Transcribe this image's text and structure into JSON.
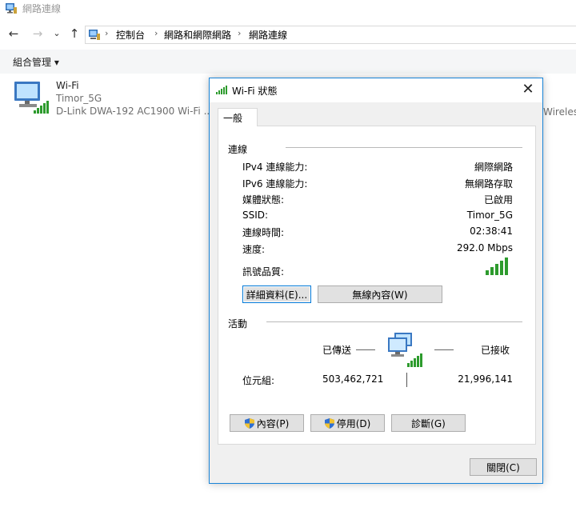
{
  "window": {
    "title": "網路連線"
  },
  "nav": {
    "back": "←",
    "forward": "→",
    "recent": "⌄",
    "up": "↑"
  },
  "breadcrumb": [
    "控制台",
    "網路和網際網路",
    "網路連線"
  ],
  "breadcrumb_sep": "›",
  "commandbar": {
    "organize": "組合管理 ▾"
  },
  "adapter": {
    "name": "Wi-Fi",
    "ssid": "Timor_5G",
    "description": "D-Link DWA-192 AC1900 Wi-Fi ...",
    "icon": "network-adapter-icon"
  },
  "background_text": "Wireles",
  "dialog": {
    "title": "Wi-Fi 狀態",
    "close": "✕",
    "tab": "一般",
    "connection": {
      "label": "連線",
      "rows": [
        {
          "label": "IPv4 連線能力:",
          "value": "網際網路"
        },
        {
          "label": "IPv6 連線能力:",
          "value": "無網路存取"
        },
        {
          "label": "媒體狀態:",
          "value": "已啟用"
        },
        {
          "label": "SSID:",
          "value": "Timor_5G"
        },
        {
          "label": "連線時間:",
          "value": "02:38:41"
        },
        {
          "label": "速度:",
          "value": "292.0 Mbps"
        }
      ],
      "signal_label": "訊號品質:",
      "signal_bars": 5
    },
    "buttons": {
      "details": "詳細資料(E)...",
      "wireless": "無線內容(W)"
    },
    "activity": {
      "label": "活動",
      "sent": "已傳送",
      "received": "已接收",
      "bytes_label": "位元組:",
      "bytes_sent": "503,462,721",
      "bytes_received": "21,996,141"
    },
    "bottom_buttons": {
      "properties": "內容(P)",
      "disable": "停用(D)",
      "diagnose": "診斷(G)"
    },
    "close_button": "關閉(C)"
  },
  "colors": {
    "accent": "#1883d7",
    "signal": "#2d9b2d",
    "shield_blue": "#2f6fd1",
    "shield_yellow": "#f2c230"
  }
}
